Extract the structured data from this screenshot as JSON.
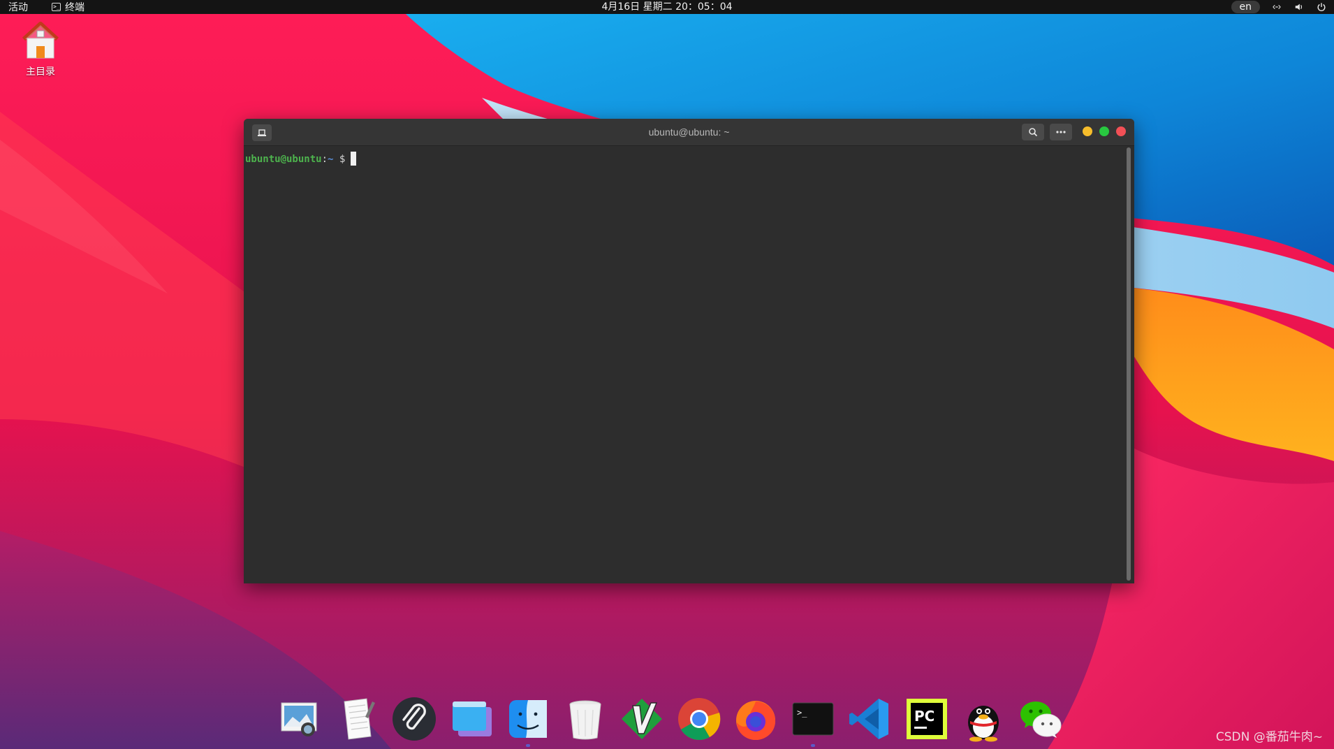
{
  "topbar": {
    "activities": "活动",
    "app_name": "终端",
    "clock": "4月16日 星期二  20：05：04",
    "input_method": "en"
  },
  "desktop": {
    "home_label": "主目录"
  },
  "terminal": {
    "title": "ubuntu@ubuntu: ~",
    "prompt_user": "ubuntu@ubuntu",
    "prompt_colon": ":",
    "prompt_path": "~",
    "prompt_symbol": "$"
  },
  "dock": {
    "items": [
      "image-viewer-icon",
      "text-editor-icon",
      "paperclip-icon",
      "window-manager-icon",
      "finder-icon",
      "trash-icon",
      "vim-icon",
      "chrome-icon",
      "firefox-icon",
      "terminal-icon",
      "vscode-icon",
      "pycharm-icon",
      "qq-icon",
      "wechat-icon"
    ]
  },
  "watermark": "CSDN @番茄牛肉~",
  "colors": {
    "topbar_bg": "#141414",
    "terminal_bg": "#2d2d2d",
    "prompt_user": "#4db34d",
    "prompt_path": "#5b8fd8",
    "minimize": "#f6bd2b",
    "maximize": "#28c840",
    "close": "#f25056"
  }
}
